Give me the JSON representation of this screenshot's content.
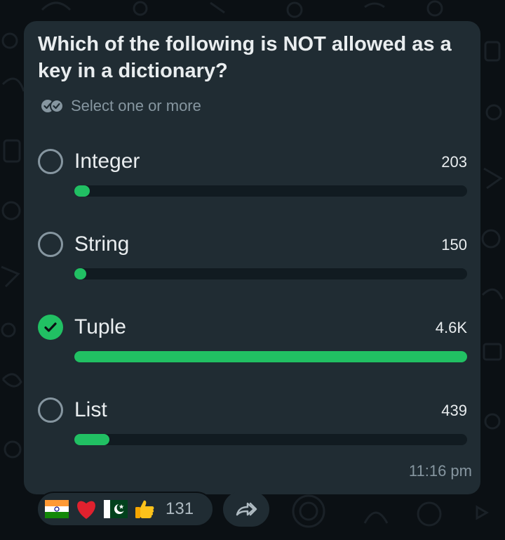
{
  "poll": {
    "question": "Which of the following is NOT allowed as a key in a dictionary?",
    "hint": "Select one or more",
    "hint_icon": "double-check-icon",
    "options": [
      {
        "label": "Integer",
        "count": "203",
        "selected": false,
        "fill_fraction": 0.04
      },
      {
        "label": "String",
        "count": "150",
        "selected": false,
        "fill_fraction": 0.03
      },
      {
        "label": "Tuple",
        "count": "4.6K",
        "selected": true,
        "fill_fraction": 1.0
      },
      {
        "label": "List",
        "count": "439",
        "selected": false,
        "fill_fraction": 0.09
      }
    ],
    "time": "11:16 pm"
  },
  "reactions": {
    "emojis": [
      "india-flag-icon",
      "red-heart-icon",
      "pakistan-flag-icon",
      "thumbs-up-icon"
    ],
    "count": "131"
  },
  "forward_icon": "forward-icon",
  "colors": {
    "accent": "#21c063",
    "bubble": "#202c33",
    "background": "#0b1014",
    "secondary_text": "#8696a0"
  }
}
